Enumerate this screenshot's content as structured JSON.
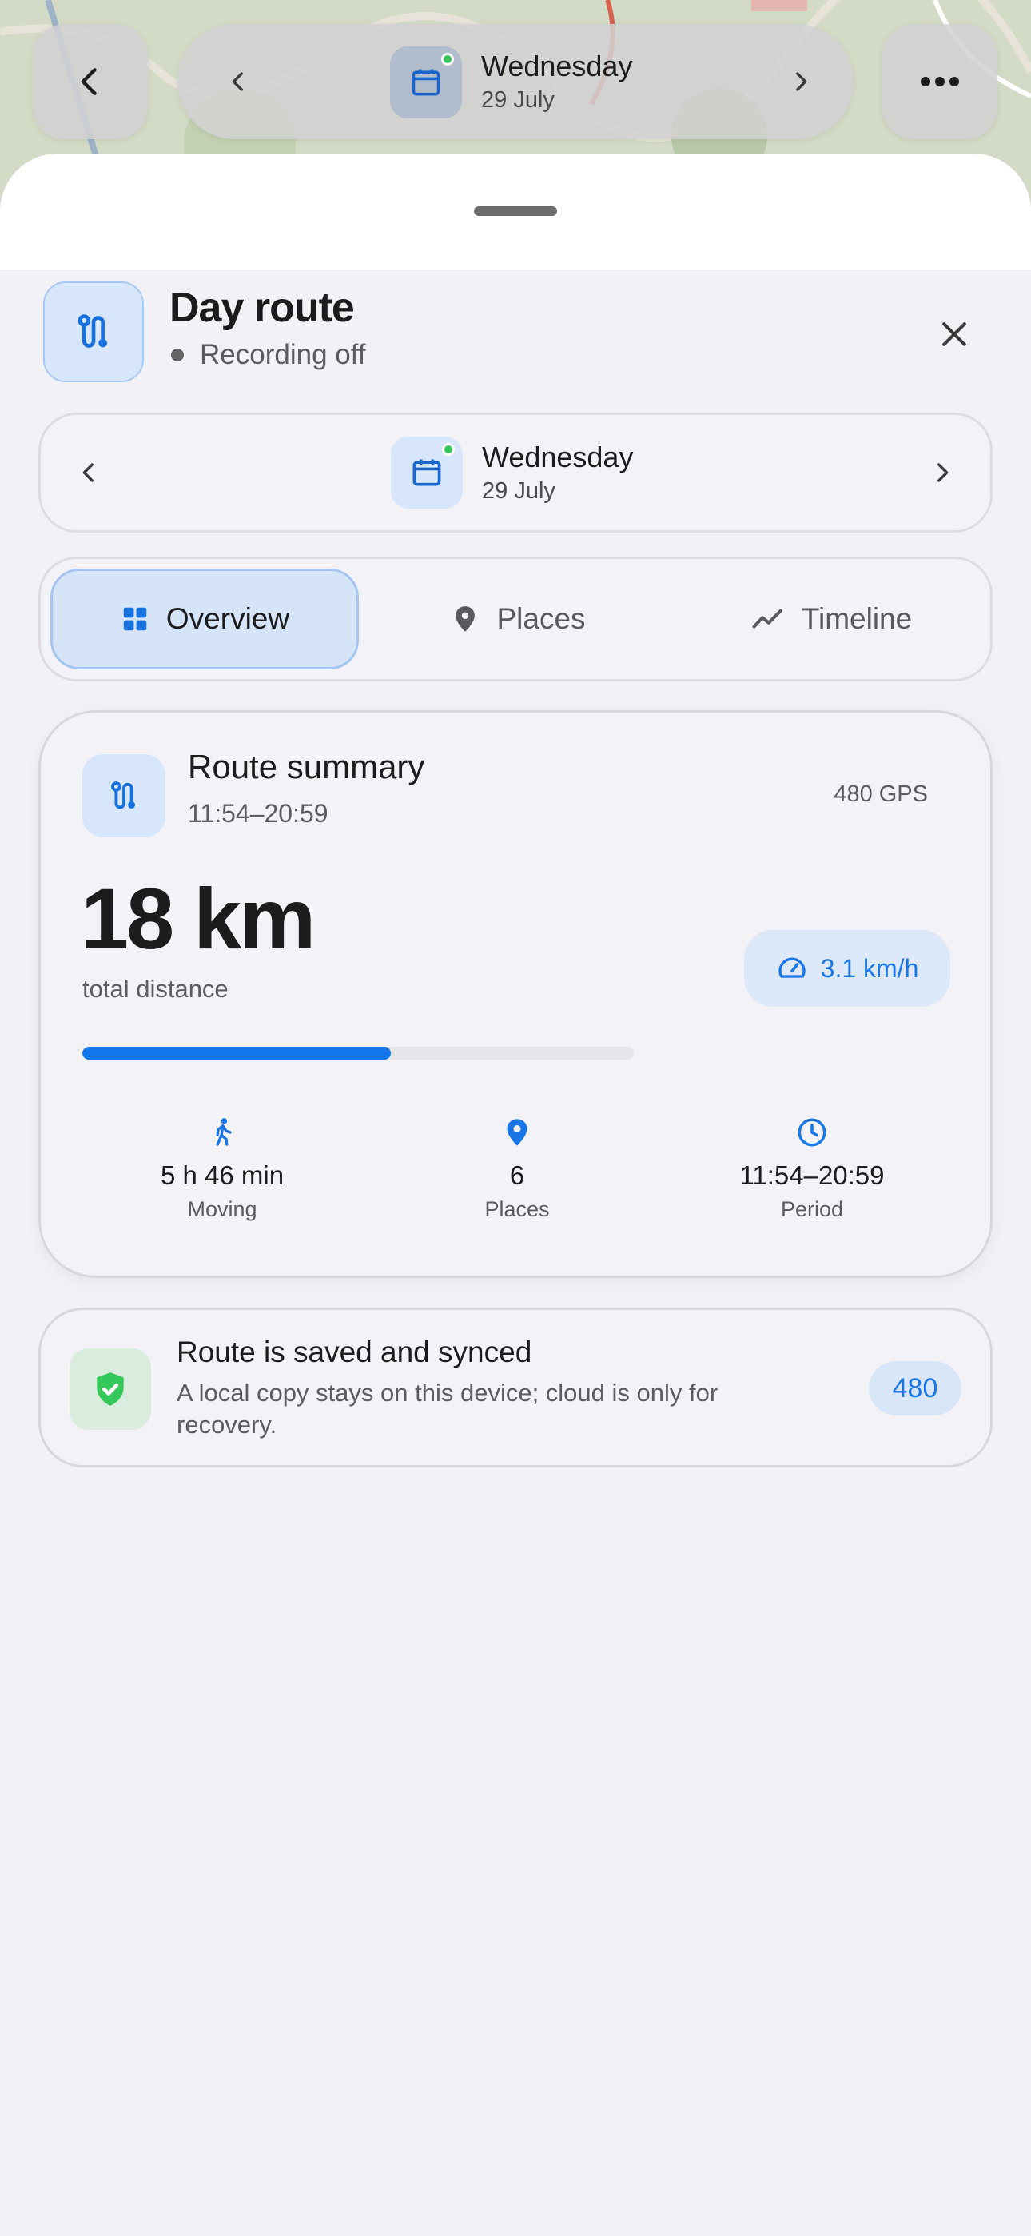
{
  "topbar": {
    "back_icon": "chevron-left-icon",
    "more_icon": "more-horizontal-icon",
    "date_picker": {
      "day": "Wednesday",
      "date": "29 July",
      "prev_icon": "chevron-left-icon",
      "next_icon": "chevron-right-icon",
      "calendar_icon": "calendar-icon"
    }
  },
  "header": {
    "title": "Day route",
    "status": "Recording off",
    "icon": "route-icon",
    "close_icon": "close-icon"
  },
  "date_selector": {
    "day": "Wednesday",
    "date": "29 July"
  },
  "tabs": [
    {
      "label": "Overview",
      "icon": "grid-icon",
      "active": true
    },
    {
      "label": "Places",
      "icon": "pin-icon",
      "active": false
    },
    {
      "label": "Timeline",
      "icon": "trend-icon",
      "active": false
    }
  ],
  "summary": {
    "title": "Route summary",
    "time_range": "11:54–20:59",
    "gps_count": "480 GPS",
    "distance": "18 km",
    "distance_label": "total distance",
    "speed": "3.1 km/h",
    "progress_fraction": 0.56,
    "stats": [
      {
        "icon": "walking-icon",
        "value": "5 h 46 min",
        "label": "Moving"
      },
      {
        "icon": "pin-icon",
        "value": "6",
        "label": "Places"
      },
      {
        "icon": "clock-icon",
        "value": "11:54–20:59",
        "label": "Period"
      }
    ]
  },
  "sync": {
    "title": "Route is saved and synced",
    "description": "A local copy stays on this device; cloud is only for recovery.",
    "badge": "480",
    "icon": "shield-check-icon"
  },
  "colors": {
    "accent": "#1177ea",
    "success": "#34c759",
    "background": "#f1f1f6"
  }
}
